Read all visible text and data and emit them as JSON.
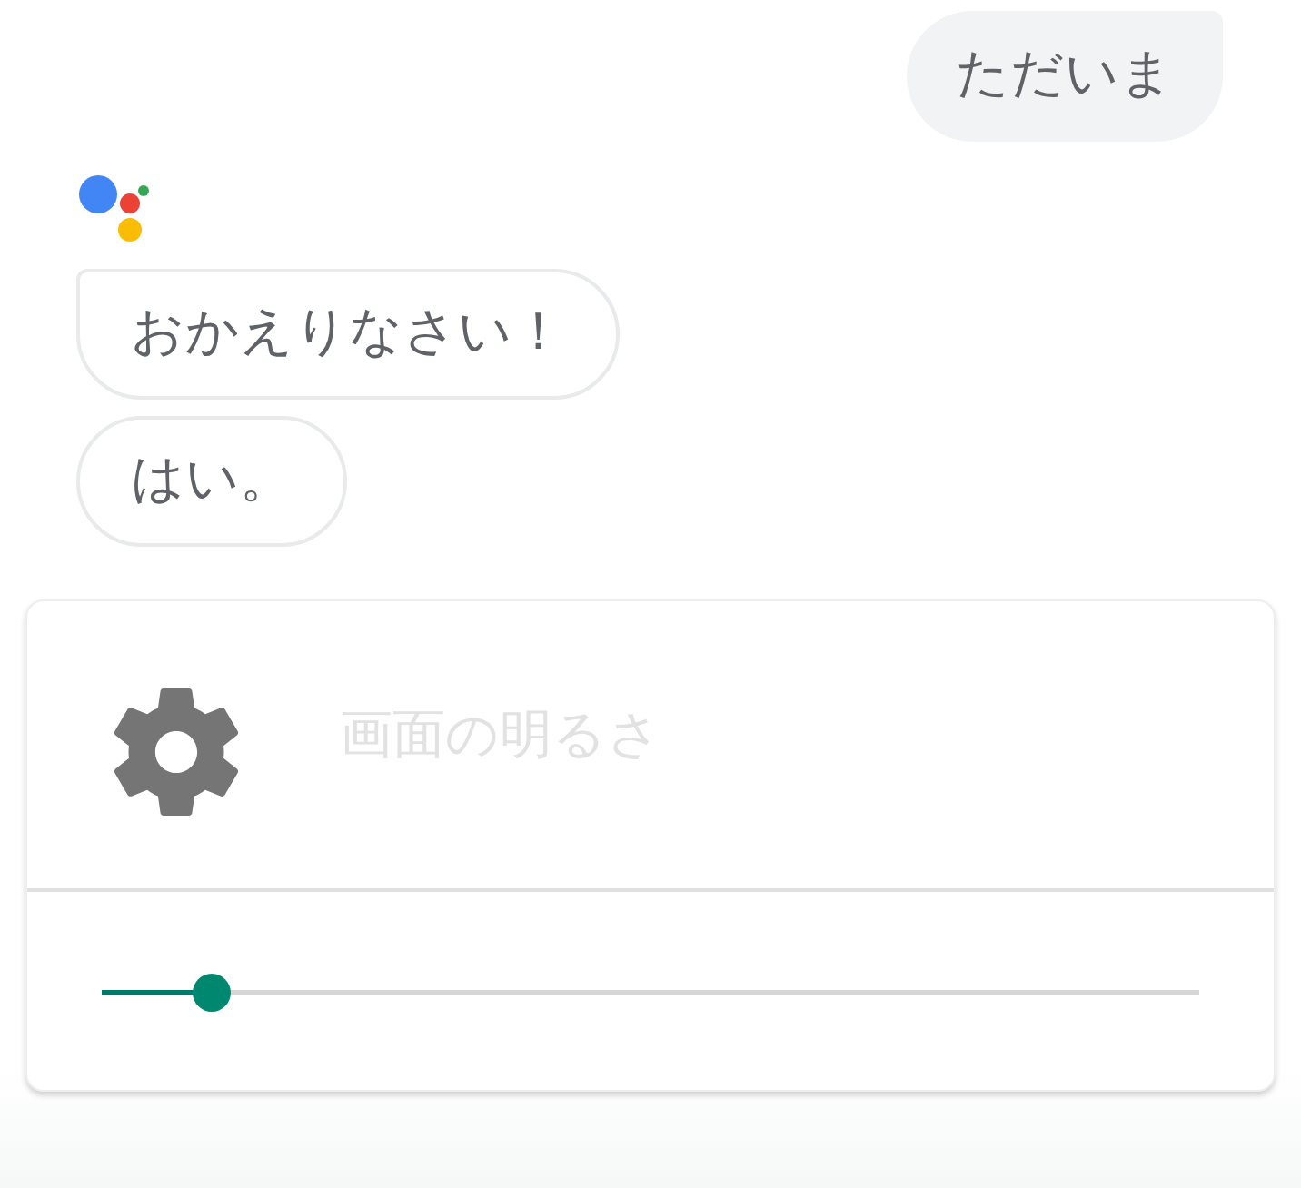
{
  "messages": [
    {
      "kind": "outgoing",
      "text": "ただいま"
    },
    {
      "kind": "incoming",
      "text": "おかえりなさい！"
    },
    {
      "kind": "incoming",
      "text": "はい。"
    }
  ],
  "card": {
    "title": "画面の明るさ",
    "slider": {
      "level": 0.1
    }
  }
}
